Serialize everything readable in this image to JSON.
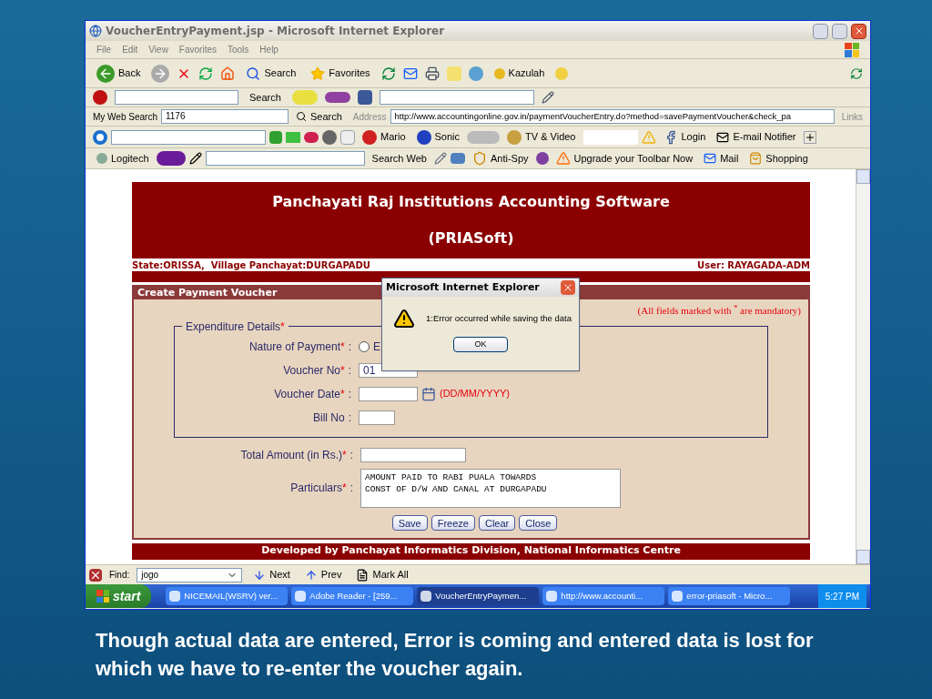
{
  "window": {
    "title": "VoucherEntryPayment.jsp - Microsoft Internet Explorer"
  },
  "menu": [
    "File",
    "Edit",
    "View",
    "Favorites",
    "Tools",
    "Help"
  ],
  "toolbar_main": [
    "Back",
    "Search",
    "Favorites",
    "Kazulah"
  ],
  "toolbar_search": {
    "button": "Search"
  },
  "toolbar_address": {
    "my_web_search": "My Web Search",
    "query": "1176",
    "search": "Search",
    "address_label": "Address",
    "url": "http://www.accountingonline.gov.in/paymentVoucherEntry.do?method=savePaymentVoucher&check_pa",
    "links": "Links"
  },
  "toolbar_games": [
    "Mario",
    "Sonic",
    "TV & Video",
    "Login",
    "E-mail Notifier"
  ],
  "toolbar_yahoo": [
    "Logitech",
    "Search Web",
    "Anti-Spy",
    "Upgrade your Toolbar Now",
    "Mail",
    "Shopping"
  ],
  "page": {
    "title": "Panchayati Raj Institutions Accounting Software",
    "subtitle": "(PRIASoft)",
    "state": "State:ORISSA,  Village Panchayat:DURGAPADU",
    "user": "User: RAYAGADA-ADM",
    "section": "Create Payment Voucher",
    "mandatory_note": "(All fields marked with $^{*}$ are mandatory)",
    "legend": "Expenditure Details",
    "legend_mark": "*",
    "fields": [
      {
        "label": "Nature of Payment",
        "mark": "*",
        "colon": ":",
        "kind": "radio",
        "option": "E",
        "selected": false
      },
      {
        "label": "Voucher No",
        "mark": "*",
        "colon": ":",
        "kind": "input",
        "value": "01"
      },
      {
        "label": "Voucher Date",
        "mark": "*",
        "colon": ":",
        "kind": "date",
        "hint": "(DD/MM/YYYY)"
      },
      {
        "label": "Bill No",
        "colon": ":",
        "kind": "short"
      }
    ],
    "total_amount": {
      "label": "Total Amount (in Rs.)",
      "mark": "*",
      "colon": ":"
    },
    "particulars": {
      "label": "Particulars",
      "mark": "*",
      "colon": ":",
      "lines": [
        "AMOUNT PAID TO RABI PUALA TOWARDS",
        "CONST OF D/W AND CANAL AT DURGAPADU"
      ]
    },
    "buttons": [
      "Save",
      "Freeze",
      "Clear",
      "Close"
    ],
    "footer": "Developed by Panchayat Informatics Division, National Informatics Centre"
  },
  "dialog": {
    "title": "Microsoft Internet Explorer",
    "message": "1:Error occurred while saving the data",
    "button": "OK"
  },
  "find_bar": {
    "label": "Find:",
    "value": "jogo",
    "next": "Next",
    "prev": "Prev",
    "mark_all": "Mark All"
  },
  "taskbar": {
    "start": "start",
    "tasks": [
      {
        "label": "NICEMAIL(WSRV) ver...",
        "selected": false
      },
      {
        "label": "Adobe Reader - [259...",
        "selected": false
      },
      {
        "label": "VoucherEntryPaymen...",
        "selected": true
      },
      {
        "label": "http://www.accounti...",
        "selected": false
      },
      {
        "label": "error-priasoft - Micro...",
        "selected": false
      }
    ],
    "time": "5:27 PM"
  },
  "caption": "Though actual data are entered, Error is coming and entered data is lost for which we have to re-enter the voucher again."
}
